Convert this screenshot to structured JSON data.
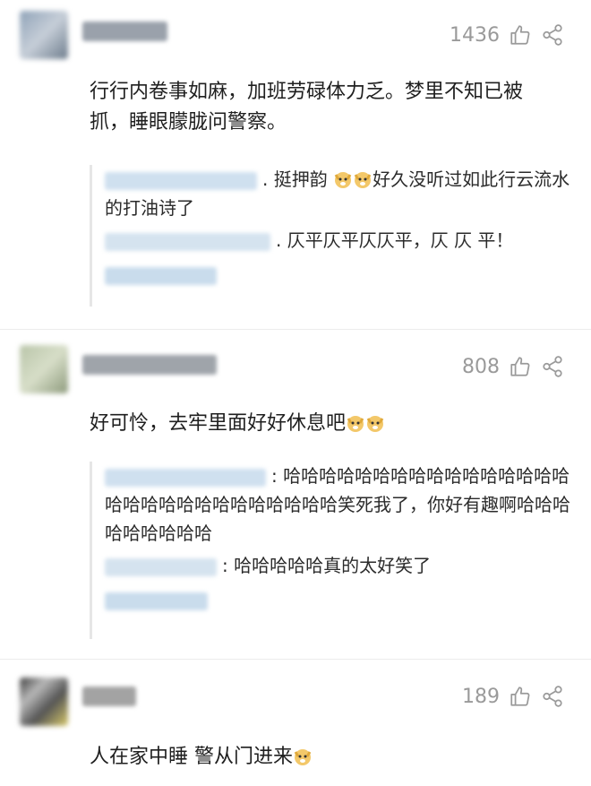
{
  "comments": [
    {
      "likes": "1436",
      "text": "行行内卷事如麻，加班劳碌体力乏。梦里不知已被抓，睡眼朦胧问警察。",
      "replies": [
        {
          "text1": "挺押韵",
          "text2": "好久没听过如此行云流水的打油诗了"
        },
        {
          "text": "仄平仄平仄仄平，仄 仄 平！"
        }
      ]
    },
    {
      "likes": "808",
      "text": "好可怜，去牢里面好好休息吧",
      "replies": [
        {
          "text": "哈哈哈哈哈哈哈哈哈哈哈哈哈哈哈哈哈哈哈哈哈哈哈哈哈哈哈哈哈笑死我了，你好有趣啊哈哈哈哈哈哈哈哈哈"
        },
        {
          "text": "哈哈哈哈哈真的太好笑了"
        }
      ]
    },
    {
      "likes": "189",
      "text": "人在家中睡 警从门进来"
    }
  ],
  "colors": {
    "meta": "#9a9a9a",
    "divider": "#ececec",
    "reply_border": "#e6e6e6"
  },
  "icons": {
    "like": "thumbs-up-icon",
    "share": "share-icon",
    "emoji": "doge-emoji-icon"
  }
}
